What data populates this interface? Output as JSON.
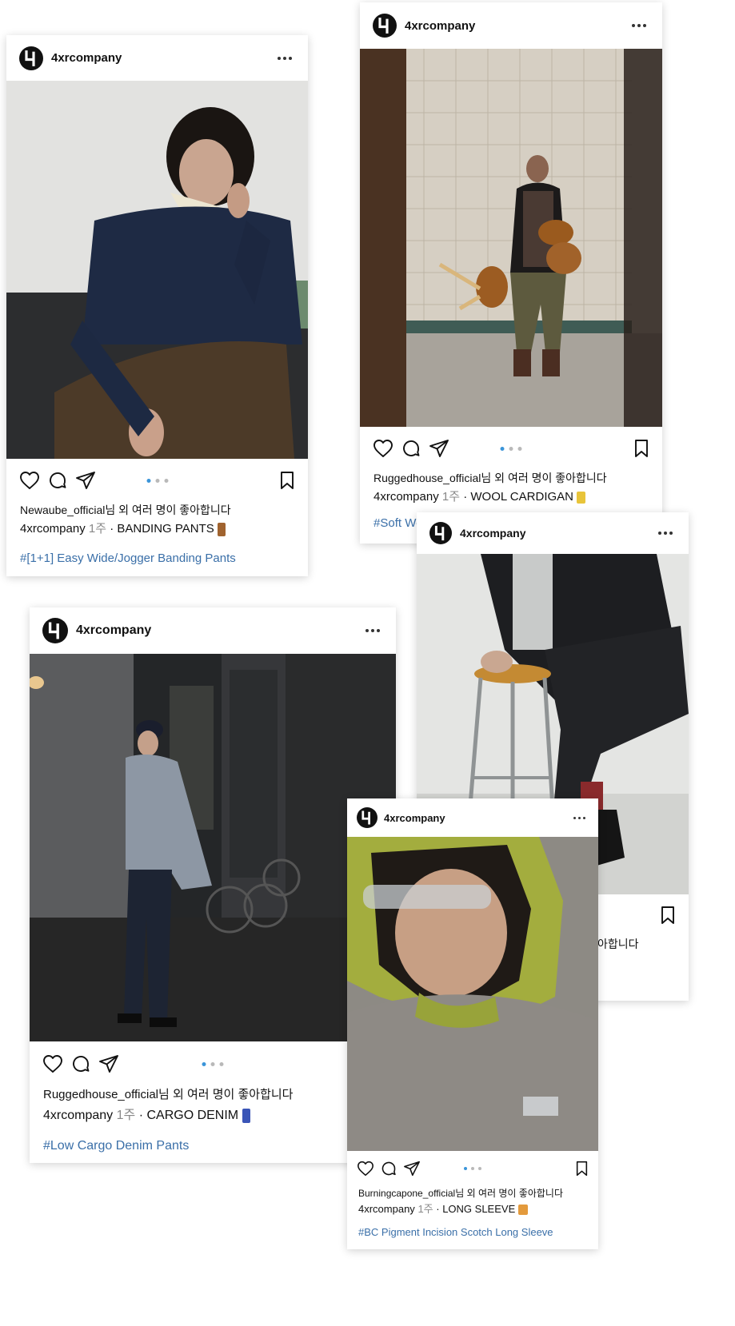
{
  "posts": [
    {
      "username": "4xrcompany",
      "liked_by": "Newaube_official",
      "liked_suffix": "님 외 여러 명이 좋아합니다",
      "author": "4xrcompany",
      "time": "1주",
      "caption": "· BANDING PANTS",
      "hashtag": "#[1+1] Easy Wide/Jogger Banding Pants",
      "photo_subject": "man-in-navy-sweater-on-sofa",
      "emoji": "pants-brown"
    },
    {
      "username": "4xrcompany",
      "liked_by": "Ruggedhouse_official",
      "liked_suffix": "님 외 여러 명이 좋아합니다",
      "author": "4xrcompany",
      "time": "1주",
      "caption": "· WOOL CARDIGAN",
      "hashtag": "#Soft Wo",
      "photo_subject": "man-carrying-stools-in-tiled-room",
      "emoji": "cardigan-yellow"
    },
    {
      "username": "4xrcompany",
      "liked_by": "",
      "liked_suffix": "아합니다",
      "photo_subject": "man-in-black-sitting-on-stool",
      "emoji": ""
    },
    {
      "username": "4xrcompany",
      "liked_by": "Ruggedhouse_official",
      "liked_suffix": "님 외 여러 명이 좋아합니다",
      "author": "4xrcompany",
      "time": "1주",
      "caption": "· CARGO DENIM",
      "hashtag": "#Low Cargo Denim Pants",
      "photo_subject": "man-in-cap-walking-in-alley",
      "emoji": "jeans-blue"
    },
    {
      "username": "4xrcompany",
      "liked_by": "Burningcapone_official",
      "liked_suffix": "님 외 여러 명이 좋아합니다",
      "author": "4xrcompany",
      "time": "1주",
      "caption": "· LONG SLEEVE",
      "hashtag": "#BC Pigment Incision Scotch Long Sleeve",
      "photo_subject": "man-in-green-hood-and-sunglasses",
      "emoji": "sweater-orange"
    }
  ],
  "icons": [
    "logo-4-icon",
    "more-icon",
    "heart-icon",
    "comment-icon",
    "share-icon",
    "bookmark-icon"
  ],
  "colors": {
    "accent": "#3b95d9",
    "hashtag": "#3a6fa8",
    "muted": "#888888"
  }
}
